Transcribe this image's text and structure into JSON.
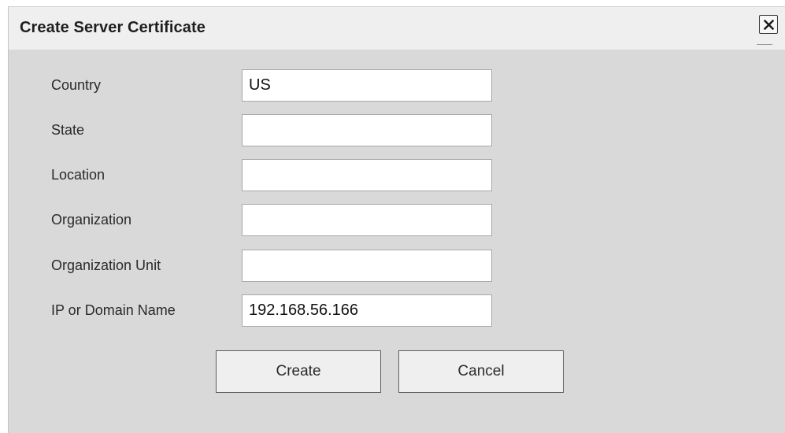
{
  "dialog": {
    "title": "Create Server Certificate",
    "close_icon": "close-icon"
  },
  "form": {
    "fields": [
      {
        "label": "Country",
        "value": "US"
      },
      {
        "label": "State",
        "value": ""
      },
      {
        "label": "Location",
        "value": ""
      },
      {
        "label": "Organization",
        "value": ""
      },
      {
        "label": "Organization Unit",
        "value": ""
      },
      {
        "label": "IP or Domain Name",
        "value": "192.168.56.166"
      }
    ]
  },
  "buttons": {
    "create_label": "Create",
    "cancel_label": "Cancel"
  },
  "colors": {
    "dialog_background": "#d9d9d9",
    "titlebar_background": "#efefef",
    "input_background": "#ffffff",
    "button_background": "#efefef"
  }
}
